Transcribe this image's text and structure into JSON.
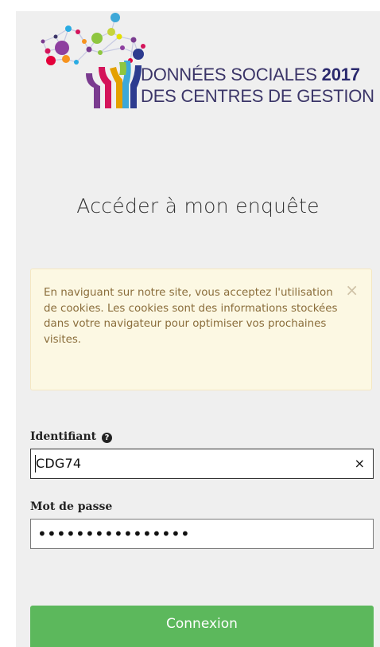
{
  "logo": {
    "line1_prefix": "DONNÉES SOCIALES ",
    "line1_year": "2017",
    "line2": "DES CENTRES DE GESTION"
  },
  "title": "Accéder à mon enquête",
  "cookie_alert": {
    "text": "En naviguant sur notre site, vous acceptez l'utilisation de cookies. Les cookies sont des informations stockées dans votre navigateur pour optimiser vos prochaines visites.",
    "close_glyph": "×"
  },
  "form": {
    "identifiant_label": "Identifiant",
    "identifiant_value": "CDG74",
    "clear_glyph": "×",
    "help_glyph": "?",
    "password_label": "Mot de passe",
    "password_mask": "••••••••••••••••",
    "submit_label": "Connexion"
  },
  "colors": {
    "panel_bg": "#efefef",
    "alert_bg": "#fcf8e3",
    "alert_text": "#8a6d3b",
    "submit_bg": "#5cb85c",
    "logo_text": "#3b3568"
  },
  "icons": {
    "logo": "network-tree-logo",
    "help": "question-circle-icon",
    "close": "close-icon",
    "clear": "clear-input-icon"
  }
}
